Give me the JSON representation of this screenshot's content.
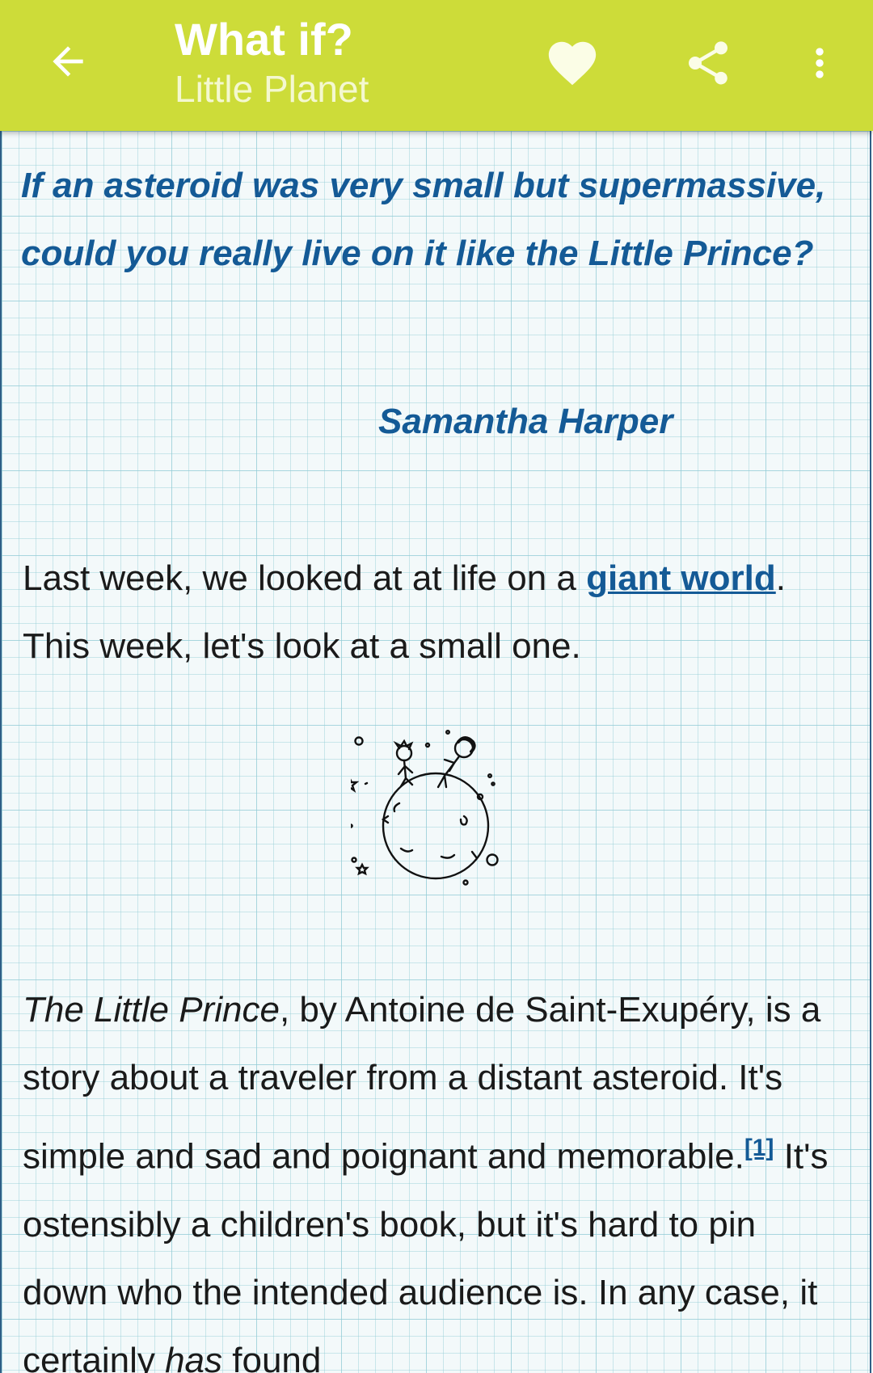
{
  "appbar": {
    "title": "What if?",
    "subtitle": "Little Planet",
    "icons": {
      "back": "arrow-back-icon",
      "favorite": "heart-icon",
      "share": "share-icon",
      "more": "more-vert-icon"
    },
    "colors": {
      "background": "#cddc39",
      "text": "#ffffff"
    }
  },
  "article": {
    "question": "If an asteroid was very small but supermassive, could you really live on it like the Little Prince?",
    "asker": "Samantha Harper",
    "intro": {
      "before_link": "Last week, we looked at at life on a ",
      "link_text": "giant world",
      "after_link": ". This week, let's look at a small one."
    },
    "body": {
      "book_title": "The Little Prince",
      "part1": ", by Antoine de Saint-Exupéry, is a story about a traveler from a distant asteroid. It's simple and sad and poignant and memorable.",
      "footnote": "[1]",
      "part2": " It's ostensibly a children's book, but it's hard to pin down who the intended audience is. In any case, it certainly ",
      "emphasis": "has",
      "part3": " found"
    },
    "colors": {
      "question": "#145a96",
      "link": "#145a96",
      "text": "#1a1a1a",
      "paper": "#f3f9fa"
    }
  }
}
